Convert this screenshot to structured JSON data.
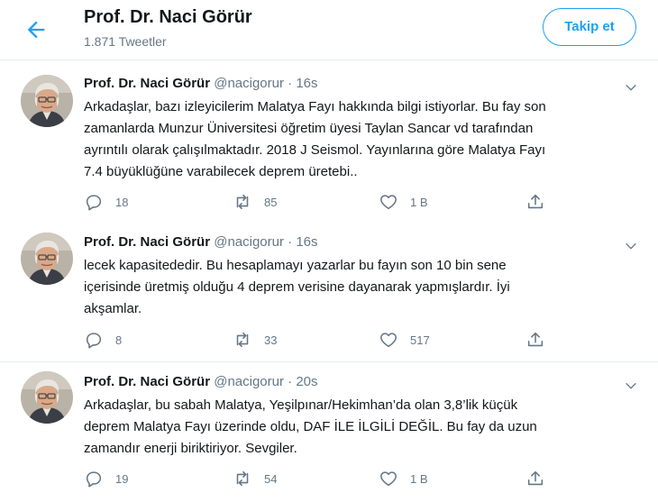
{
  "header": {
    "name": "Prof. Dr. Naci Görür",
    "tweet_count": "1.871 Tweetler",
    "follow_label": "Takip et"
  },
  "colors": {
    "accent": "#1da1f2",
    "muted": "#657786",
    "border": "#e6ecf0"
  },
  "icons": {
    "back": "arrow-left-icon",
    "caret": "chevron-down-icon",
    "reply": "reply-icon",
    "retweet": "retweet-icon",
    "like": "heart-icon",
    "share": "share-icon"
  },
  "tweets": [
    {
      "name": "Prof. Dr. Naci Görür",
      "handle": "@nacigorur",
      "dot": "·",
      "time": "16s",
      "text": "Arkadaşlar, bazı izleyicilerim Malatya Fayı hakkında bilgi istiyorlar. Bu fay son\nzamanlarda Munzur Üniversitesi öğretim üyesi Taylan Sancar vd tarafından\nayrıntılı olarak çalışılmaktadır. 2018 J Seismol. Yayınlarına göre Malatya Fayı\n7.4 büyüklüğüne varabilecek deprem üretebi..",
      "replies": "18",
      "retweets": "85",
      "likes": "1 B"
    },
    {
      "name": "Prof. Dr. Naci Görür",
      "handle": "@nacigorur",
      "dot": "·",
      "time": "16s",
      "text": "lecek kapasitededir. Bu hesaplamayı yazarlar bu fayın son 10 bin sene\niçerisinde üretmiş olduğu 4 deprem verisine dayanarak yapmışlardır. İyi\nakşamlar.",
      "replies": "8",
      "retweets": "33",
      "likes": "517"
    },
    {
      "name": "Prof. Dr. Naci Görür",
      "handle": "@nacigorur",
      "dot": "·",
      "time": "20s",
      "text": "Arkadaşlar, bu sabah Malatya, Yeşilpınar/Hekimhan’da olan 3,8’lik küçük\ndeprem Malatya Fayı üzerinde oldu, DAF İLE İLGİLİ DEĞİL. Bu fay da uzun\nzamandır enerji biriktiriyor. Sevgiler.",
      "replies": "19",
      "retweets": "54",
      "likes": "1 B"
    }
  ]
}
